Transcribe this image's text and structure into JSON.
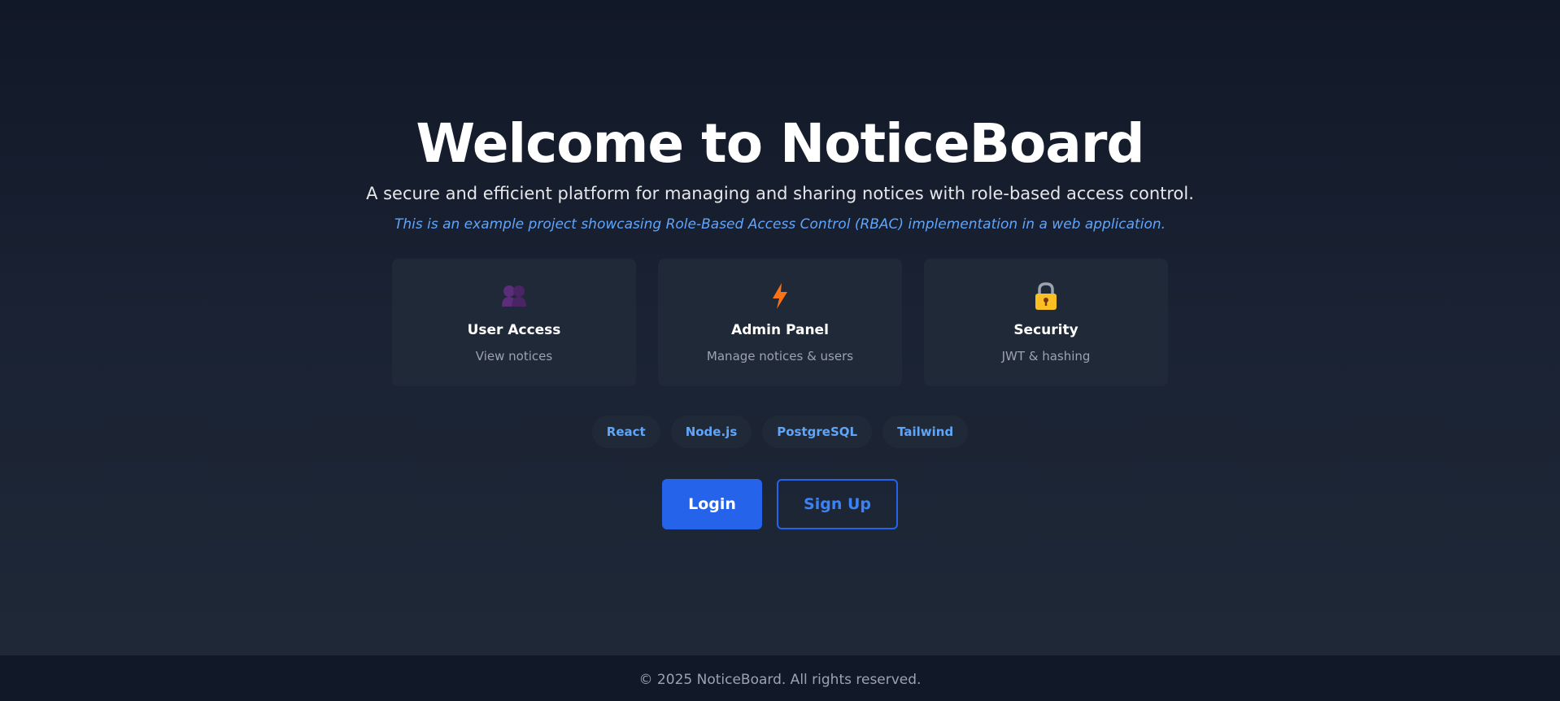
{
  "hero": {
    "title": "Welcome to NoticeBoard",
    "subtitle": "A secure and efficient platform for managing and sharing notices with role-based access control.",
    "note": "This is an example project showcasing Role-Based Access Control (RBAC) implementation in a web application."
  },
  "features": [
    {
      "icon": "users-icon",
      "icon_color": "#5b2d7a",
      "title": "User Access",
      "description": "View notices"
    },
    {
      "icon": "lightning-icon",
      "icon_color": "#f97316",
      "title": "Admin Panel",
      "description": "Manage notices & users"
    },
    {
      "icon": "lock-icon",
      "icon_color": "#fbbf24",
      "title": "Security",
      "description": "JWT & hashing"
    }
  ],
  "tech_tags": [
    "React",
    "Node.js",
    "PostgreSQL",
    "Tailwind"
  ],
  "actions": {
    "login_label": "Login",
    "signup_label": "Sign Up"
  },
  "footer": {
    "text": "© 2025 NoticeBoard. All rights reserved."
  },
  "colors": {
    "background_top": "#111827",
    "background_bottom": "#1f2937",
    "accent": "#2563eb",
    "link": "#60a5fa",
    "card": "#1f2937"
  }
}
